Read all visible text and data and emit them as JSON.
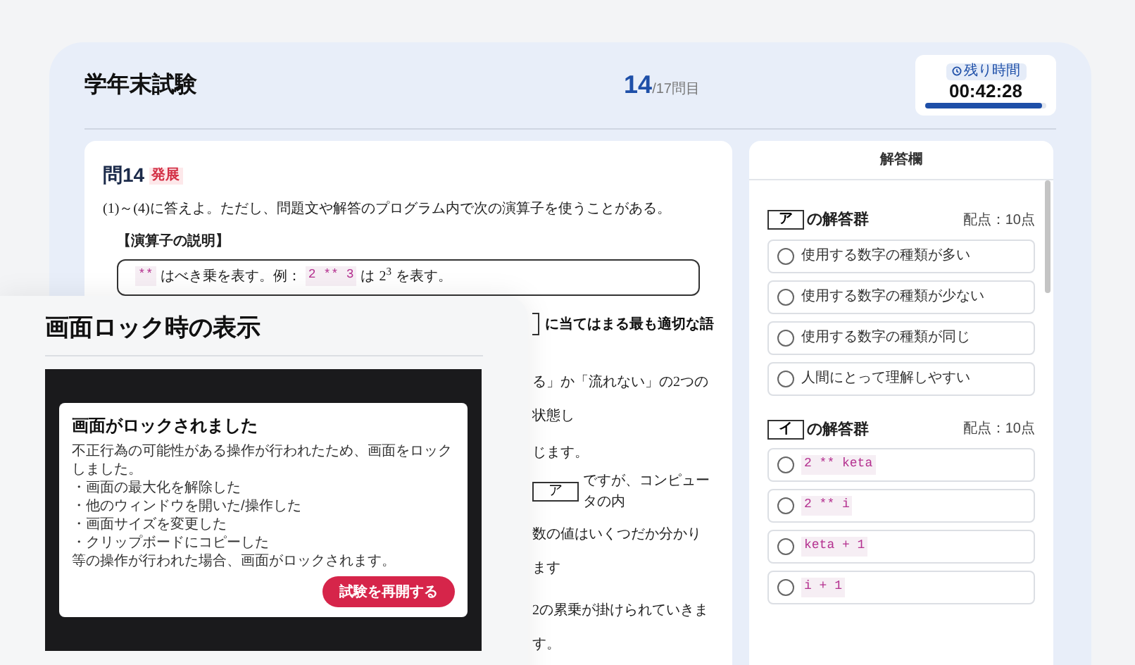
{
  "header": {
    "title": "学年末試験",
    "current": "14",
    "total": "/17問目"
  },
  "timer": {
    "label": "残り時間",
    "time": "00:42:28",
    "level": 0.96
  },
  "question": {
    "number": "問14",
    "badge": "発展",
    "intro": "(1)～(4)に答えよ。ただし、問題文や解答のプログラム内で次の演算子を使うことがある。",
    "section_title": "【演算子の説明】",
    "operator_line": [
      {
        "kind": "code",
        "text": "**"
      },
      {
        "kind": "text",
        "text": "はべき乗を表す。例："
      },
      {
        "kind": "code",
        "text": "2 ** 3"
      },
      {
        "kind": "text",
        "text": "は"
      },
      {
        "kind": "text",
        "text": "2$^{3}$"
      },
      {
        "kind": "text",
        "text": "を表す。"
      }
    ],
    "lines": [
      {
        "kind": "edge_heading",
        "text": "に当てはまる最も適切な語"
      },
      {
        "kind": "text",
        "text": "る」か「流れない」の2つの状態し"
      },
      {
        "kind": "text",
        "text": "じます。"
      },
      {
        "kind": "blank_text",
        "blank": "ア",
        "text": "ですが、コンピュータの内"
      },
      {
        "kind": "text",
        "text": "数の値はいくつだか分かります"
      },
      {
        "kind": "text",
        "text": "2の累乗が掛けられていきます。"
      }
    ]
  },
  "answer_panel": {
    "title": "解答欄",
    "groups": [
      {
        "blank": "ア",
        "label": "の解答群",
        "points": "配点：10点",
        "options": [
          {
            "kind": "text",
            "text": "使用する数字の種類が多い",
            "selected": false
          },
          {
            "kind": "text",
            "text": "使用する数字の種類が少ない",
            "selected": false
          },
          {
            "kind": "text",
            "text": "使用する数字の種類が同じ",
            "selected": false
          },
          {
            "kind": "text",
            "text": "人間にとって理解しやすい",
            "selected": false
          }
        ]
      },
      {
        "blank": "イ",
        "label": "の解答群",
        "points": "配点：10点",
        "options": [
          {
            "kind": "code",
            "text": "2 ** keta",
            "selected": false
          },
          {
            "kind": "code",
            "text": "2 ** i",
            "selected": false
          },
          {
            "kind": "code",
            "text": "keta + 1",
            "selected": false
          },
          {
            "kind": "code",
            "text": "i + 1",
            "selected": false
          }
        ]
      }
    ]
  },
  "lock_panel": {
    "title": "画面ロック時の表示",
    "dialog": {
      "title": "画面がロックされました",
      "lines": [
        "不正行為の可能性がある操作が行われたため、画面をロックしました。",
        "・画面の最大化を解除した",
        "・他のウィンドウを開いた/操作した",
        "・画面サイズを変更した",
        "・クリップボードにコピーした",
        "等の操作が行われた場合、画面がロックされます。"
      ],
      "button": "試験を再開する"
    }
  }
}
